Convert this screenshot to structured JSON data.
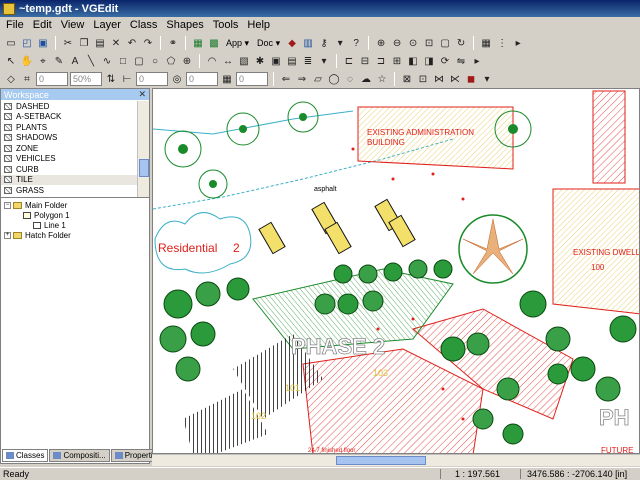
{
  "window": {
    "title": "~temp.gdt - VGEdit"
  },
  "menu": [
    "File",
    "Edit",
    "View",
    "Layer",
    "Class",
    "Shapes",
    "Tools",
    "Help"
  ],
  "toolbar1": {
    "app_label": "App",
    "doc_label": "Doc"
  },
  "toolbar3": {
    "zoom_value": "50%"
  },
  "workspace": {
    "title": "Workspace",
    "layers": [
      "DASHED",
      "A-SETBACK",
      "PLANTS",
      "SHADOWS",
      "ZONE",
      "VEHICLES",
      "CURB",
      "TILE",
      "GRASS"
    ],
    "selected_layer": "TILE",
    "tree": {
      "main_folder": "Main Folder",
      "polygon": "Polygon 1",
      "line": "Line 1",
      "hatch_folder": "Hatch Folder"
    },
    "tabs": [
      "Classes",
      "Compositi...",
      "Properties"
    ]
  },
  "drawing": {
    "labels": {
      "admin": "EXISTING ADMINISTRATION",
      "admin2": "BUILDING",
      "dwell": "EXISTING DWELL",
      "residential": "Residential",
      "residential_num": "2",
      "phase": "PHASE 2",
      "asphalt": "asphalt",
      "future": "FUTURE",
      "ph": "PH",
      "finished_floor": "24.7 finished floor",
      "lot100": "100",
      "lot101": "101",
      "lot102": "102",
      "lot103": "103"
    },
    "colors": {
      "survey_red": "#e0201a",
      "tree_green": "#1a8a2a",
      "boundary_cyan": "#3ab0c8",
      "lot_yellow": "#f2e06a"
    }
  },
  "status": {
    "ready": "Ready",
    "scale": "1 : 197.561",
    "coords": "3476.586 : -2706.140 [in]"
  }
}
